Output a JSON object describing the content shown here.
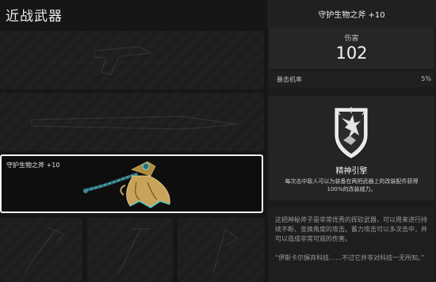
{
  "left_panel": {
    "title": "近战武器",
    "selected_item_name": "守护生物之斧 +10"
  },
  "detail_panel": {
    "weapon_name": "守护生物之斧 +10",
    "damage_label": "伤害",
    "damage_value": "102",
    "crit_label": "暴击机率",
    "crit_value": "5%",
    "perk_name": "精神引擎",
    "perk_description": "每次击中敌人可以为装备在两把武器上的改装配件获得100%的改装威力。",
    "description": "这把神秘斧子是非常优秀的挥砍武器，可以用来进行持续不断、变换角度的攻击。蓄力攻击可以多次击中，并可以造成非常可观的伤害。",
    "quote": "“伊斯卡尔摒弃科技……不过它并非对科技一无所知。”"
  },
  "icons": {
    "perk_icon": "spirit-engine-icon",
    "weapon_icon": "guardian-axe-icon"
  },
  "colors": {
    "selection_border": "#f4f4f4",
    "panel_background": "#1b1b1b"
  }
}
